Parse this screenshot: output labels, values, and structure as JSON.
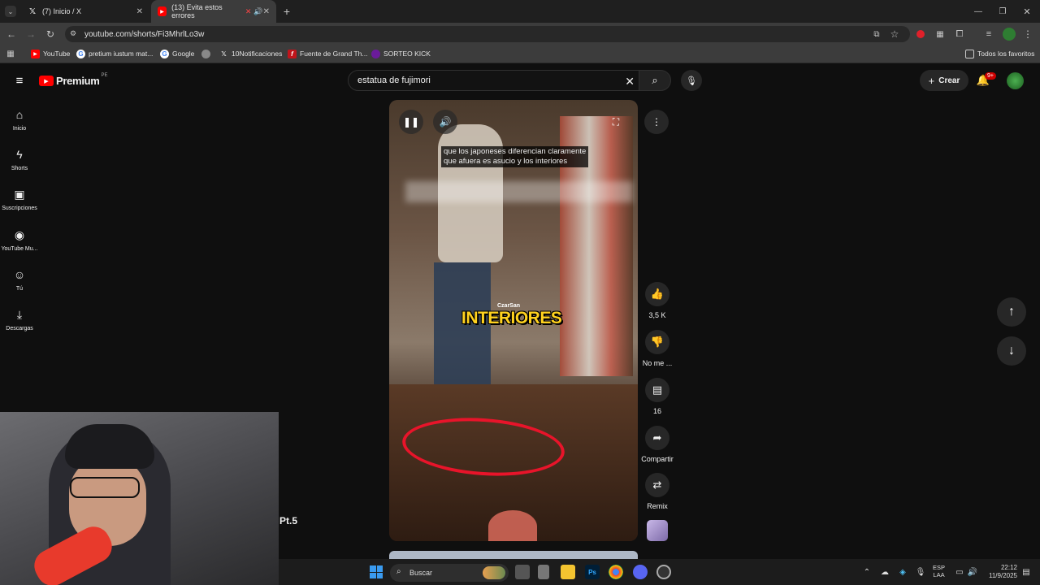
{
  "browser": {
    "tabs": [
      {
        "title": "(7) Inicio / X",
        "icon": "x-logo-icon"
      },
      {
        "title": "(13) Evita estos errores",
        "icon": "youtube-icon",
        "active": true
      }
    ],
    "url": "youtube.com/shorts/Fi3MhrlLo3w",
    "bookmarks": [
      "YouTube",
      "pretium iustum mat...",
      "Google",
      "",
      "10Notificaciones",
      "Fuente de Grand Th...",
      "SORTEO KICK"
    ],
    "all_bookmarks": "Todos los favoritos"
  },
  "youtube": {
    "logo": "Premium",
    "region": "PE",
    "search_value": "estatua de fujimori",
    "create_label": "Crear",
    "notif_count": "9+",
    "sidebar": [
      {
        "label": "Inicio",
        "icon": "home-icon"
      },
      {
        "label": "Shorts",
        "icon": "shorts-icon"
      },
      {
        "label": "Suscripciones",
        "icon": "subscriptions-icon"
      },
      {
        "label": "YouTube Mu...",
        "icon": "music-icon"
      },
      {
        "label": "Tú",
        "icon": "user-icon"
      },
      {
        "label": "Descargas",
        "icon": "download-icon"
      }
    ],
    "video": {
      "caption_line1": "que los japoneses diferencian claramente",
      "caption_line2": "que afuera es asucio y los interiores",
      "brand": "CzarSan",
      "overlay_word": "INTERIORES"
    },
    "actions": {
      "likes": "3,5 K",
      "dislike": "No me ...",
      "comments": "16",
      "share": "Compartir",
      "remix": "Remix"
    },
    "overlay_label": "Pt.5"
  },
  "taskbar": {
    "search": "Buscar",
    "lang1": "ESP",
    "lang2": "LAA",
    "time": "22:12",
    "date": "11/9/2025"
  },
  "colors": {
    "youtube_red": "#ff0000",
    "overlay_yellow": "#ffd21f",
    "bg": "#0f0f0f"
  }
}
